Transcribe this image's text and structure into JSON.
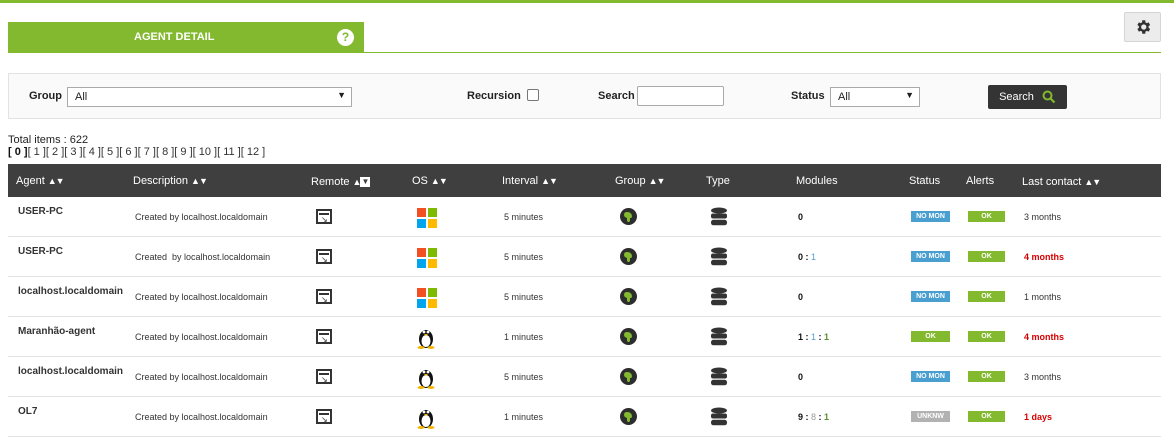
{
  "tab": {
    "title": "AGENT DETAIL",
    "help": "?"
  },
  "filter": {
    "group_label": "Group",
    "group_value": "All",
    "recursion_label": "Recursion",
    "search_label": "Search",
    "search_value": "",
    "status_label": "Status",
    "status_value": "All",
    "search_button": "Search"
  },
  "summary": {
    "total_items": "Total items : 622",
    "pages_current": "[ 0 ]",
    "pages_rest": "[ 1 ][ 2 ][ 3 ][ 4 ][ 5 ][ 6 ][ 7 ][ 8 ][ 9 ][ 10 ][ 11 ][ 12 ]"
  },
  "table": {
    "headers": {
      "agent": "Agent",
      "description": "Description",
      "remote": "Remote",
      "os": "OS",
      "interval": "Interval",
      "group": "Group",
      "type": "Type",
      "modules": "Modules",
      "status": "Status",
      "alerts": "Alerts",
      "last_contact": "Last contact"
    },
    "rows": [
      {
        "agent": "USER-PC",
        "description": "Created by localhost.localdomain",
        "os": "windows-icon",
        "interval": "5 minutes",
        "modules": {
          "total": "0",
          "sep1": "",
          "second": "",
          "sep2": "",
          "third": ""
        },
        "status": "NO MON",
        "status_color": "#4a9fd1",
        "alert": "OK",
        "last_contact": "3 months",
        "last_red": false
      },
      {
        "agent": "USER-PC",
        "description": "Created  by localhost.localdomain",
        "os": "windows-icon",
        "interval": "5 minutes",
        "modules": {
          "total": "0",
          "sep1": " : ",
          "second": "1",
          "sep2": "",
          "third": ""
        },
        "status": "NO MON",
        "status_color": "#4a9fd1",
        "alert": "OK",
        "last_contact": "4 months",
        "last_red": true
      },
      {
        "agent": "localhost.localdomain",
        "description": "Created by localhost.localdomain",
        "os": "windows-icon",
        "interval": "5 minutes",
        "modules": {
          "total": "0",
          "sep1": "",
          "second": "",
          "sep2": "",
          "third": ""
        },
        "status": "NO MON",
        "status_color": "#4a9fd1",
        "alert": "OK",
        "last_contact": "1 months",
        "last_red": false
      },
      {
        "agent": "Maranhão-agent",
        "description": "Created by localhost.localdomain",
        "os": "linux-icon",
        "interval": "1 minutes",
        "modules": {
          "total": "1",
          "sep1": " : ",
          "second": "1",
          "sep2": " : ",
          "third": "1"
        },
        "status": "OK",
        "status_color": "#82b92e",
        "alert": "OK",
        "last_contact": "4 months",
        "last_red": true
      },
      {
        "agent": "localhost.localdomain",
        "description": "Created by localhost.localdomain",
        "os": "linux-icon",
        "interval": "5 minutes",
        "modules": {
          "total": "0",
          "sep1": "",
          "second": "",
          "sep2": "",
          "third": ""
        },
        "status": "NO MON",
        "status_color": "#4a9fd1",
        "alert": "OK",
        "last_contact": "3 months",
        "last_red": false
      },
      {
        "agent": "OL7",
        "description": "Created by localhost.localdomain",
        "os": "linux-icon",
        "interval": "1 minutes",
        "modules": {
          "total": "9",
          "sep1": " : ",
          "second": "8",
          "sep2": " : ",
          "third": "1"
        },
        "status": "UNKNW",
        "status_color": "#b2b2b2",
        "alert": "OK",
        "last_contact": "1 days",
        "last_red": true
      }
    ]
  }
}
